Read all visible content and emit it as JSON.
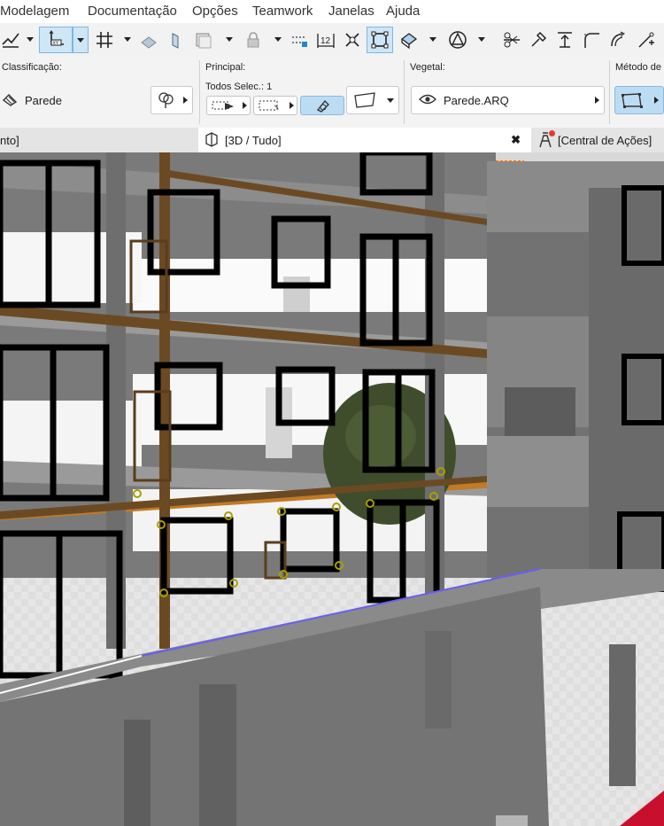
{
  "menu": [
    "Modelagem",
    "Documentação",
    "Opções",
    "Teamwork",
    "Janelas",
    "Ajuda"
  ],
  "toolbar_icons": [
    "suspend-groups-icon",
    "coordinate-plane-icon",
    "grid-snap-icon",
    "guideline-icon",
    "parallel-icon",
    "layer-icon",
    "lock-icon",
    "renovation-icon",
    "dimension-12-icon",
    "intersect-icon",
    "selection-frame-icon",
    "shape-3d-icon",
    "trim-icon",
    "split-icon",
    "adjust-icon",
    "elevation-icon",
    "fillet-icon",
    "offset-icon",
    "add-point-icon"
  ],
  "infobox": {
    "classification_label": "Classificação:",
    "classification_value": "Parede",
    "main_label": "Principal:",
    "select_all_label": "Todos Selec.: 1",
    "vegetal_label": "Vegetal:",
    "vegetal_value": "Parede.ARQ",
    "method_label": "Método de"
  },
  "tabs": {
    "left_partial": "nto]",
    "view3d": "[3D / Tudo]",
    "close": "✖",
    "action_center": "[Central de Ações]"
  },
  "colors": {
    "accent": "#1e88d2",
    "window_frame": "#000000",
    "beam": "#6b4a23",
    "tree": "#3f4d2c",
    "notification": "#e53935"
  }
}
